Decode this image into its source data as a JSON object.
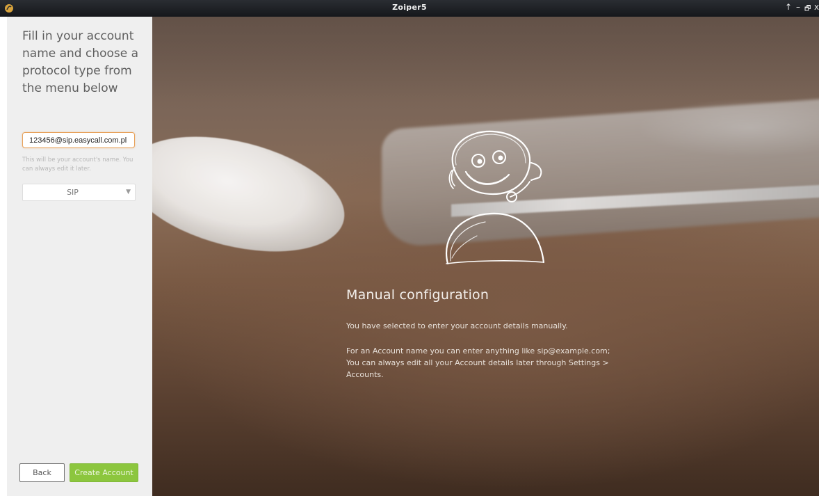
{
  "window": {
    "title": "Zoiper5",
    "controls": {
      "up": "↑",
      "minimize": "–",
      "restore": "🗗",
      "close": "x"
    },
    "colors": {
      "titlebar": "#1b1d21"
    }
  },
  "sidebar": {
    "heading": "Fill in your account name and choose a protocol type from the menu below",
    "account_input": {
      "value": "123456@sip.easycall.com.pl",
      "placeholder": ""
    },
    "hint": "This will be your account's name. You can always edit it later.",
    "protocol_select": {
      "value": "SIP",
      "icon": "chevron-down-icon"
    },
    "back_label": "Back",
    "create_label": "Create Account",
    "colors": {
      "accent_green": "#8cc63e",
      "input_focus": "#e7a15a"
    }
  },
  "main": {
    "title": "Manual configuration",
    "paragraph1": "You have selected to enter your account details manually.",
    "paragraph2": "For an Account name you can enter anything like sip@example.com; You can always edit all your Account details later through Settings > Accounts.",
    "illustration": "support-avatar-icon"
  }
}
